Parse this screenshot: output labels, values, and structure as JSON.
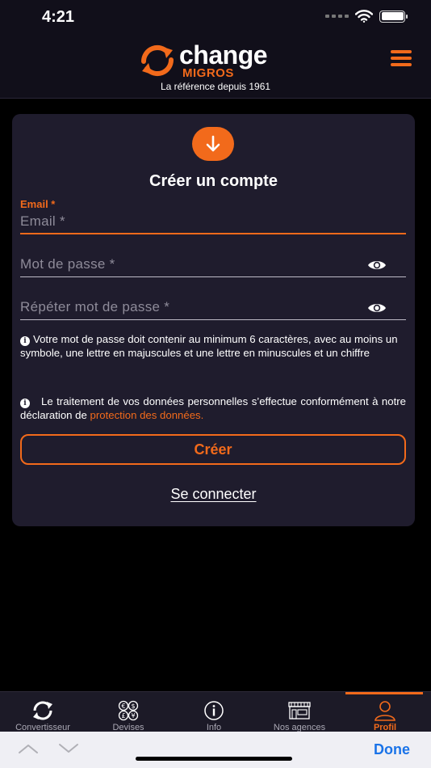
{
  "status": {
    "time": "4:21"
  },
  "header": {
    "logo_word": "change",
    "logo_sub": "MIGROS",
    "tagline": "La référence depuis 1961"
  },
  "form": {
    "title": "Créer un compte",
    "email": {
      "label": "Email *",
      "placeholder": "Email *",
      "value": ""
    },
    "password": {
      "placeholder": "Mot de passe *",
      "value": ""
    },
    "repeat_password": {
      "placeholder": "Répéter mot de passe *",
      "value": ""
    },
    "password_hint": "Votre mot de passe doit contenir au minimum 6 caractères, avec au moins un symbole, une lettre en majuscules et une lettre en minuscules et un chiffre",
    "privacy_text": "Le traitement de vos données personnelles s’effectue conformément à notre déclaration de ",
    "privacy_link": "protection des données.",
    "create_label": "Créer",
    "login_label": "Se connecter"
  },
  "tabs": [
    {
      "label": "Convertisseur",
      "icon": "refresh-icon"
    },
    {
      "label": "Devises",
      "icon": "currencies-icon"
    },
    {
      "label": "Info",
      "icon": "info-icon"
    },
    {
      "label": "Nos agences",
      "icon": "store-icon"
    },
    {
      "label": "Profil",
      "icon": "person-icon",
      "active": true
    }
  ],
  "keyboard_bar": {
    "done_label": "Done"
  },
  "colors": {
    "accent": "#f26a1b",
    "card": "#1f1c2d",
    "header": "#110f1a",
    "link_blue": "#1a73e8"
  }
}
